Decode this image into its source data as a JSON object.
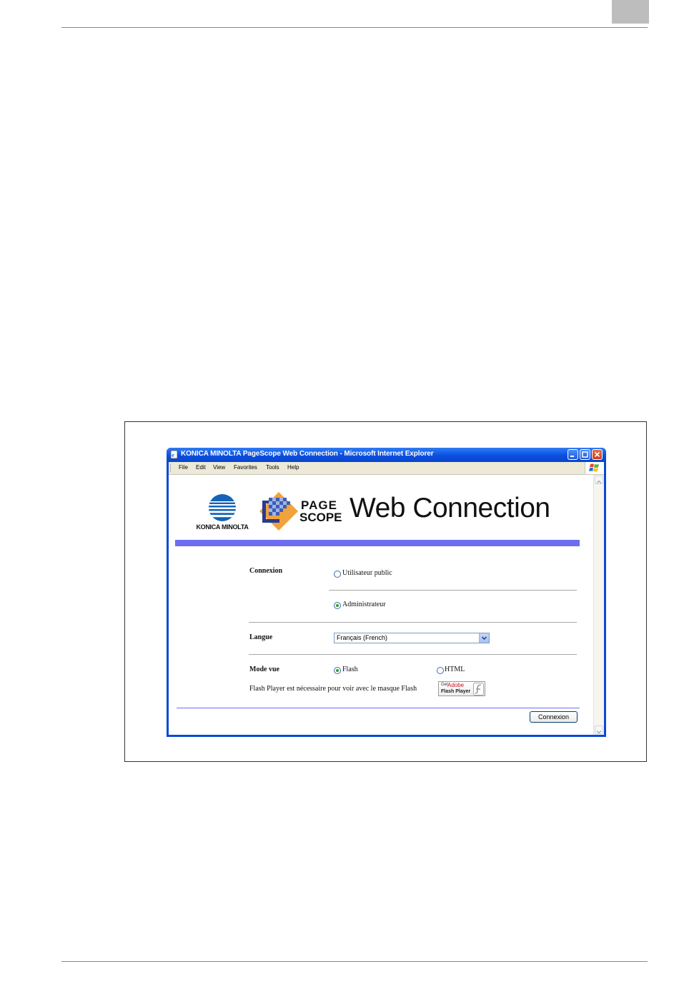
{
  "window": {
    "title": "KONICA MINOLTA PageScope Web Connection - Microsoft Internet Explorer"
  },
  "menubar": {
    "items": [
      "File",
      "Edit",
      "View",
      "Favorites",
      "Tools",
      "Help"
    ]
  },
  "header": {
    "brand": "KONICA MINOLTA",
    "product_line1": "PAGE",
    "product_line2": "SCOPE",
    "product_name": "Web Connection"
  },
  "login": {
    "connexion_label": "Connexion",
    "public_user_label": "Utilisateur public",
    "admin_label": "Administrateur",
    "selected_user": "Administrateur",
    "langue_label": "Langue",
    "langue_value": "Français (French)",
    "mode_label": "Mode vue",
    "flash_label": "Flash",
    "html_label": "HTML",
    "selected_mode": "Flash",
    "flash_note": "Flash Player est nécessaire pour voir avec le masque Flash",
    "submit_label": "Connexion"
  },
  "flash_badge": {
    "get": "Get",
    "adobe": "Adobe",
    "player": "Flash Player"
  },
  "colors": {
    "titlebar": "#0b4fe0",
    "accent_bar": "#6d6df2",
    "radio_checked": "#2d9c2d"
  }
}
